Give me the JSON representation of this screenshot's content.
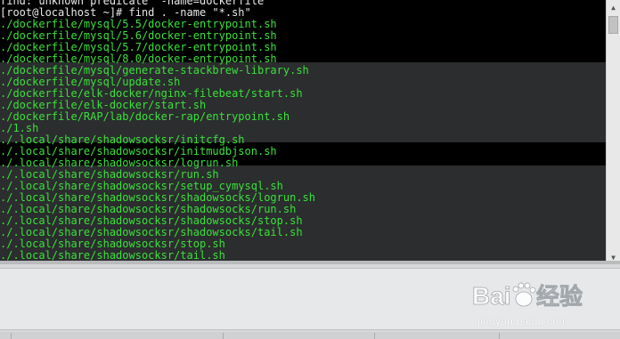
{
  "terminal": {
    "lines": [
      {
        "text": "find: unknown predicate `-name=dockerfile'",
        "kind": "prompt"
      },
      {
        "text": "[root@localhost ~]# find . -name \"*.sh\"",
        "kind": "prompt"
      },
      {
        "text": "./dockerfile/mysql/5.5/docker-entrypoint.sh",
        "kind": "output"
      },
      {
        "text": "./dockerfile/mysql/5.6/docker-entrypoint.sh",
        "kind": "output"
      },
      {
        "text": "./dockerfile/mysql/5.7/docker-entrypoint.sh",
        "kind": "output"
      },
      {
        "text": "./dockerfile/mysql/8.0/docker-entrypoint.sh",
        "kind": "output"
      },
      {
        "text": "./dockerfile/mysql/generate-stackbrew-library.sh",
        "kind": "output"
      },
      {
        "text": "./dockerfile/mysql/update.sh",
        "kind": "output"
      },
      {
        "text": "./dockerfile/elk-docker/nginx-filebeat/start.sh",
        "kind": "output"
      },
      {
        "text": "./dockerfile/elk-docker/start.sh",
        "kind": "output"
      },
      {
        "text": "./dockerfile/RAP/lab/docker-rap/entrypoint.sh",
        "kind": "output"
      },
      {
        "text": "./1.sh",
        "kind": "output"
      },
      {
        "text": "./.local/share/shadowsocksr/initcfg.sh",
        "kind": "output"
      },
      {
        "text": "./.local/share/shadowsocksr/initmudbjson.sh",
        "kind": "output"
      },
      {
        "text": "./.local/share/shadowsocksr/logrun.sh",
        "kind": "output"
      },
      {
        "text": "./.local/share/shadowsocksr/run.sh",
        "kind": "output"
      },
      {
        "text": "./.local/share/shadowsocksr/setup_cymysql.sh",
        "kind": "output"
      },
      {
        "text": "./.local/share/shadowsocksr/shadowsocks/logrun.sh",
        "kind": "output"
      },
      {
        "text": "./.local/share/shadowsocksr/shadowsocks/run.sh",
        "kind": "output"
      },
      {
        "text": "./.local/share/shadowsocksr/shadowsocks/stop.sh",
        "kind": "output"
      },
      {
        "text": "./.local/share/shadowsocksr/shadowsocks/tail.sh",
        "kind": "output"
      },
      {
        "text": "./.local/share/shadowsocksr/stop.sh",
        "kind": "output"
      },
      {
        "text": "./.local/share/shadowsocksr/tail.sh",
        "kind": "output"
      }
    ]
  },
  "colors": {
    "output_text": "#3ce03c",
    "prompt_text": "#e9e9e9",
    "terminal_bg": "#000000",
    "highlight_band": "#2b2d2e"
  },
  "scrollbar": {
    "up_icon": "triangle-up-icon",
    "down_icon": "triangle-down-icon"
  },
  "watermark": {
    "logo": "Baidu经验",
    "subtitle": "jingyan.baidu.com"
  }
}
